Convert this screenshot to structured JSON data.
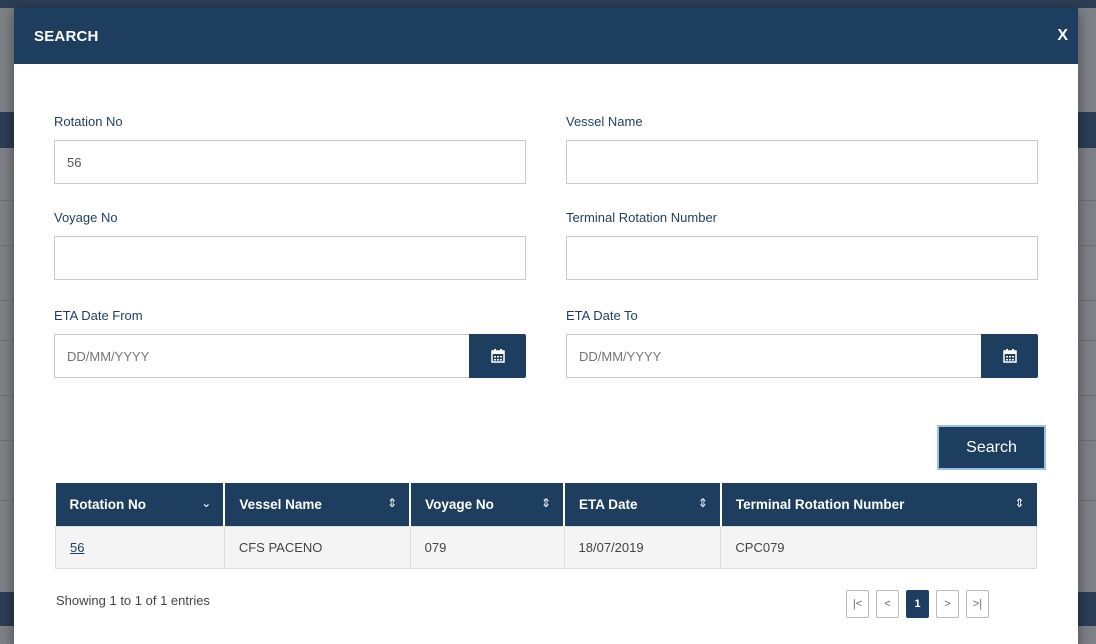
{
  "modal": {
    "title": "SEARCH",
    "close_label": "X"
  },
  "form": {
    "rotation_no": {
      "label": "Rotation No",
      "value": "56"
    },
    "vessel_name": {
      "label": "Vessel Name",
      "value": ""
    },
    "voyage_no": {
      "label": "Voyage No",
      "value": ""
    },
    "terminal_rotation": {
      "label": "Terminal Rotation Number",
      "value": ""
    },
    "eta_from": {
      "label": "ETA Date From",
      "placeholder": "DD/MM/YYYY"
    },
    "eta_to": {
      "label": "ETA Date To",
      "placeholder": "DD/MM/YYYY"
    },
    "search_label": "Search"
  },
  "table": {
    "headers": [
      "Rotation No",
      "Vessel Name",
      "Voyage No",
      "ETA Date",
      "Terminal Rotation Number"
    ],
    "sort_icons": [
      "⌄",
      "⇕",
      "⇕",
      "⇕",
      "⇕"
    ],
    "rows": [
      [
        "56",
        "CFS PACENO",
        "079",
        "18/07/2019",
        "CPC079"
      ]
    ]
  },
  "footer": {
    "info": "Showing 1 to 1 of 1 entries",
    "pager": [
      "|<",
      "<",
      "1",
      ">",
      ">|"
    ]
  },
  "colors": {
    "primary": "#1d3e5f",
    "accent_border": "#9cc0e3"
  }
}
